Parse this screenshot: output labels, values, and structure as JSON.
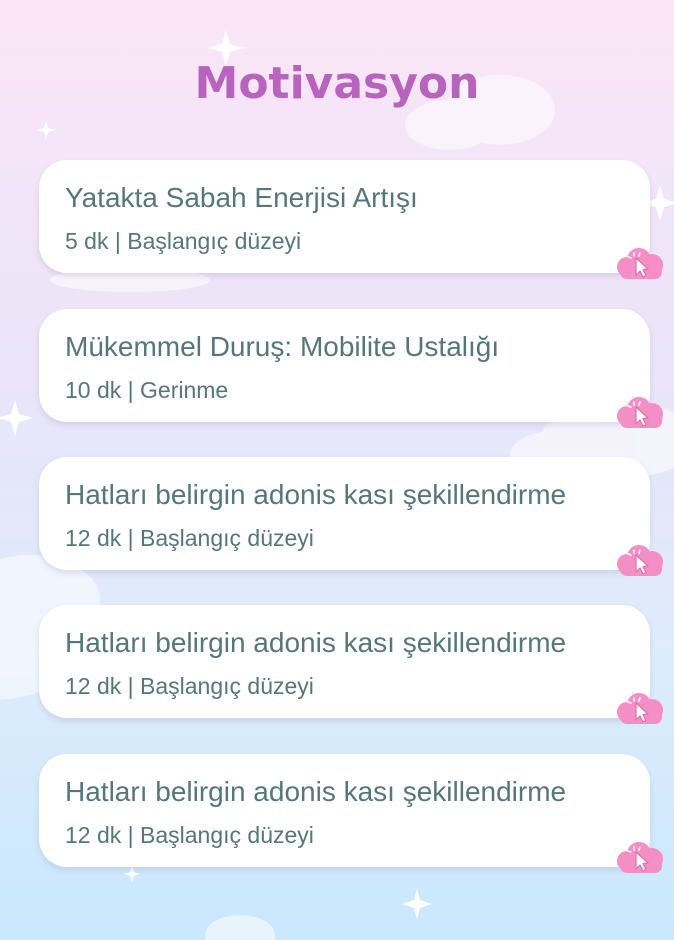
{
  "page_title": "Motivasyon",
  "workouts": [
    {
      "title": "Yatakta Sabah Enerjisi Artışı",
      "meta": "5 dk | Başlangıç düzeyi"
    },
    {
      "title": "Mükemmel Duruş: Mobilite Ustalığı",
      "meta": "10 dk | Gerinme"
    },
    {
      "title": "Hatları belirgin adonis kası şekillendirme",
      "meta": "12 dk | Başlangıç düzeyi"
    },
    {
      "title": "Hatları belirgin adonis kası şekillendirme",
      "meta": "12 dk | Başlangıç düzeyi"
    },
    {
      "title": "Hatları belirgin adonis kası şekillendirme",
      "meta": "12 dk | Başlangıç düzeyi"
    }
  ],
  "icons": {
    "card_action": "pink-cloud-pointer-icon",
    "decoration": "sparkle-icon"
  },
  "colors": {
    "title": "#b863bd",
    "card_text": "#55777a",
    "cloud": "#f48fc5"
  }
}
